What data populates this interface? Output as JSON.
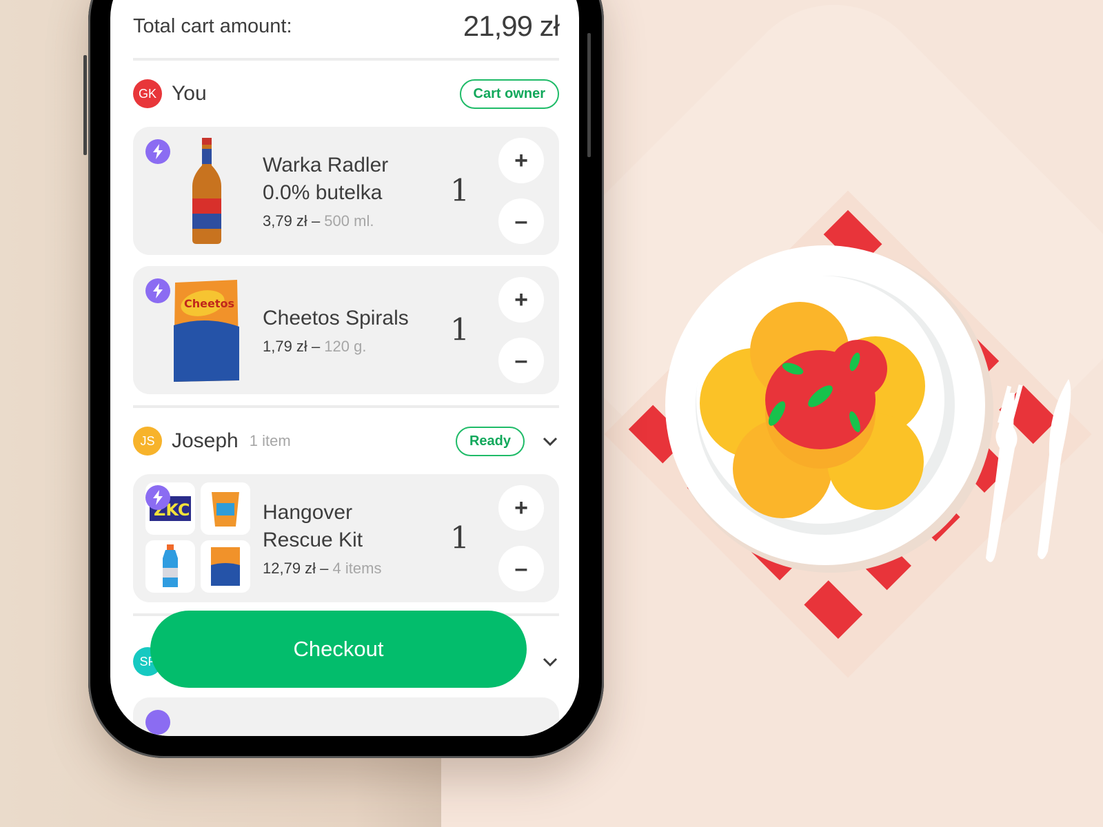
{
  "cart": {
    "total_label": "Total cart amount:",
    "total_amount": "21,99 zł"
  },
  "members": [
    {
      "initials": "GK",
      "name": "You",
      "avatar_color": "#e8363a",
      "badge": "Cart owner",
      "items": [
        {
          "name_line1": "Warka Radler",
          "name_line2": "0.0% butelka",
          "price": "3,79 zł",
          "separator": " – ",
          "size": "500 ml.",
          "quantity": "1",
          "express_icon": "bolt-icon"
        },
        {
          "name_line1": "Cheetos Spirals",
          "name_line2": "",
          "price": "1,79 zł",
          "separator": " – ",
          "size": "120 g.",
          "quantity": "1",
          "express_icon": "bolt-icon"
        }
      ]
    },
    {
      "initials": "JS",
      "name": "Joseph",
      "meta": "1 item",
      "avatar_color": "#f7b32b",
      "badge": "Ready",
      "items": [
        {
          "name_line1": "Hangover",
          "name_line2": "Rescue Kit",
          "price": "12,79 zł",
          "separator": " – ",
          "size": "4 items",
          "quantity": "1",
          "express_icon": "bolt-icon"
        }
      ]
    },
    {
      "initials": "SF",
      "avatar_color": "#16c9c1"
    }
  ],
  "controls": {
    "plus": "+",
    "minus": "–"
  },
  "checkout_label": "Checkout",
  "colors": {
    "accent_green": "#03bd6c",
    "express_purple": "#8b6cf2",
    "background": "#f4e4d8"
  }
}
